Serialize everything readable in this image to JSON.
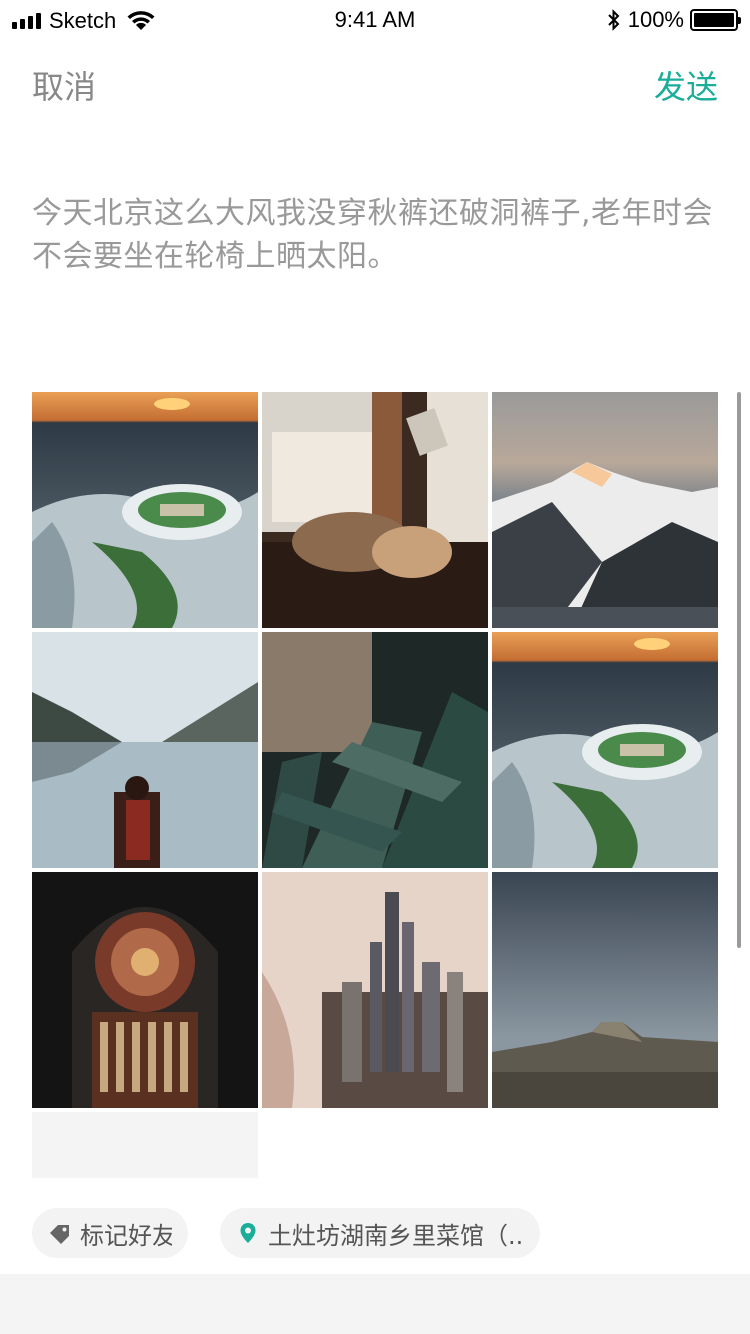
{
  "status_bar": {
    "carrier": "Sketch",
    "time": "9:41 AM",
    "battery": "100%",
    "battery_level": 1.0
  },
  "nav": {
    "cancel_label": "取消",
    "send_label": "发送"
  },
  "post": {
    "text": "今天北京这么大风我没穿秋裤还破洞裤子,老年时会不会要坐在轮椅上晒太阳。"
  },
  "photos": [
    {
      "subject": "aerial-stadium-sunset"
    },
    {
      "subject": "girls-reading-window"
    },
    {
      "subject": "snowy-mountain"
    },
    {
      "subject": "man-by-lake"
    },
    {
      "subject": "palm-leaves"
    },
    {
      "subject": "aerial-stadium-sunset"
    },
    {
      "subject": "cathedral-organ"
    },
    {
      "subject": "shanghai-skyline"
    },
    {
      "subject": "half-dome"
    }
  ],
  "tags": {
    "friends_label": "标记好友",
    "location_label": "土灶坊湖南乡里菜馆（..."
  },
  "icons": {
    "tag": "tag-icon",
    "location": "location-pin-icon"
  },
  "colors": {
    "accent": "#1aad9a"
  }
}
